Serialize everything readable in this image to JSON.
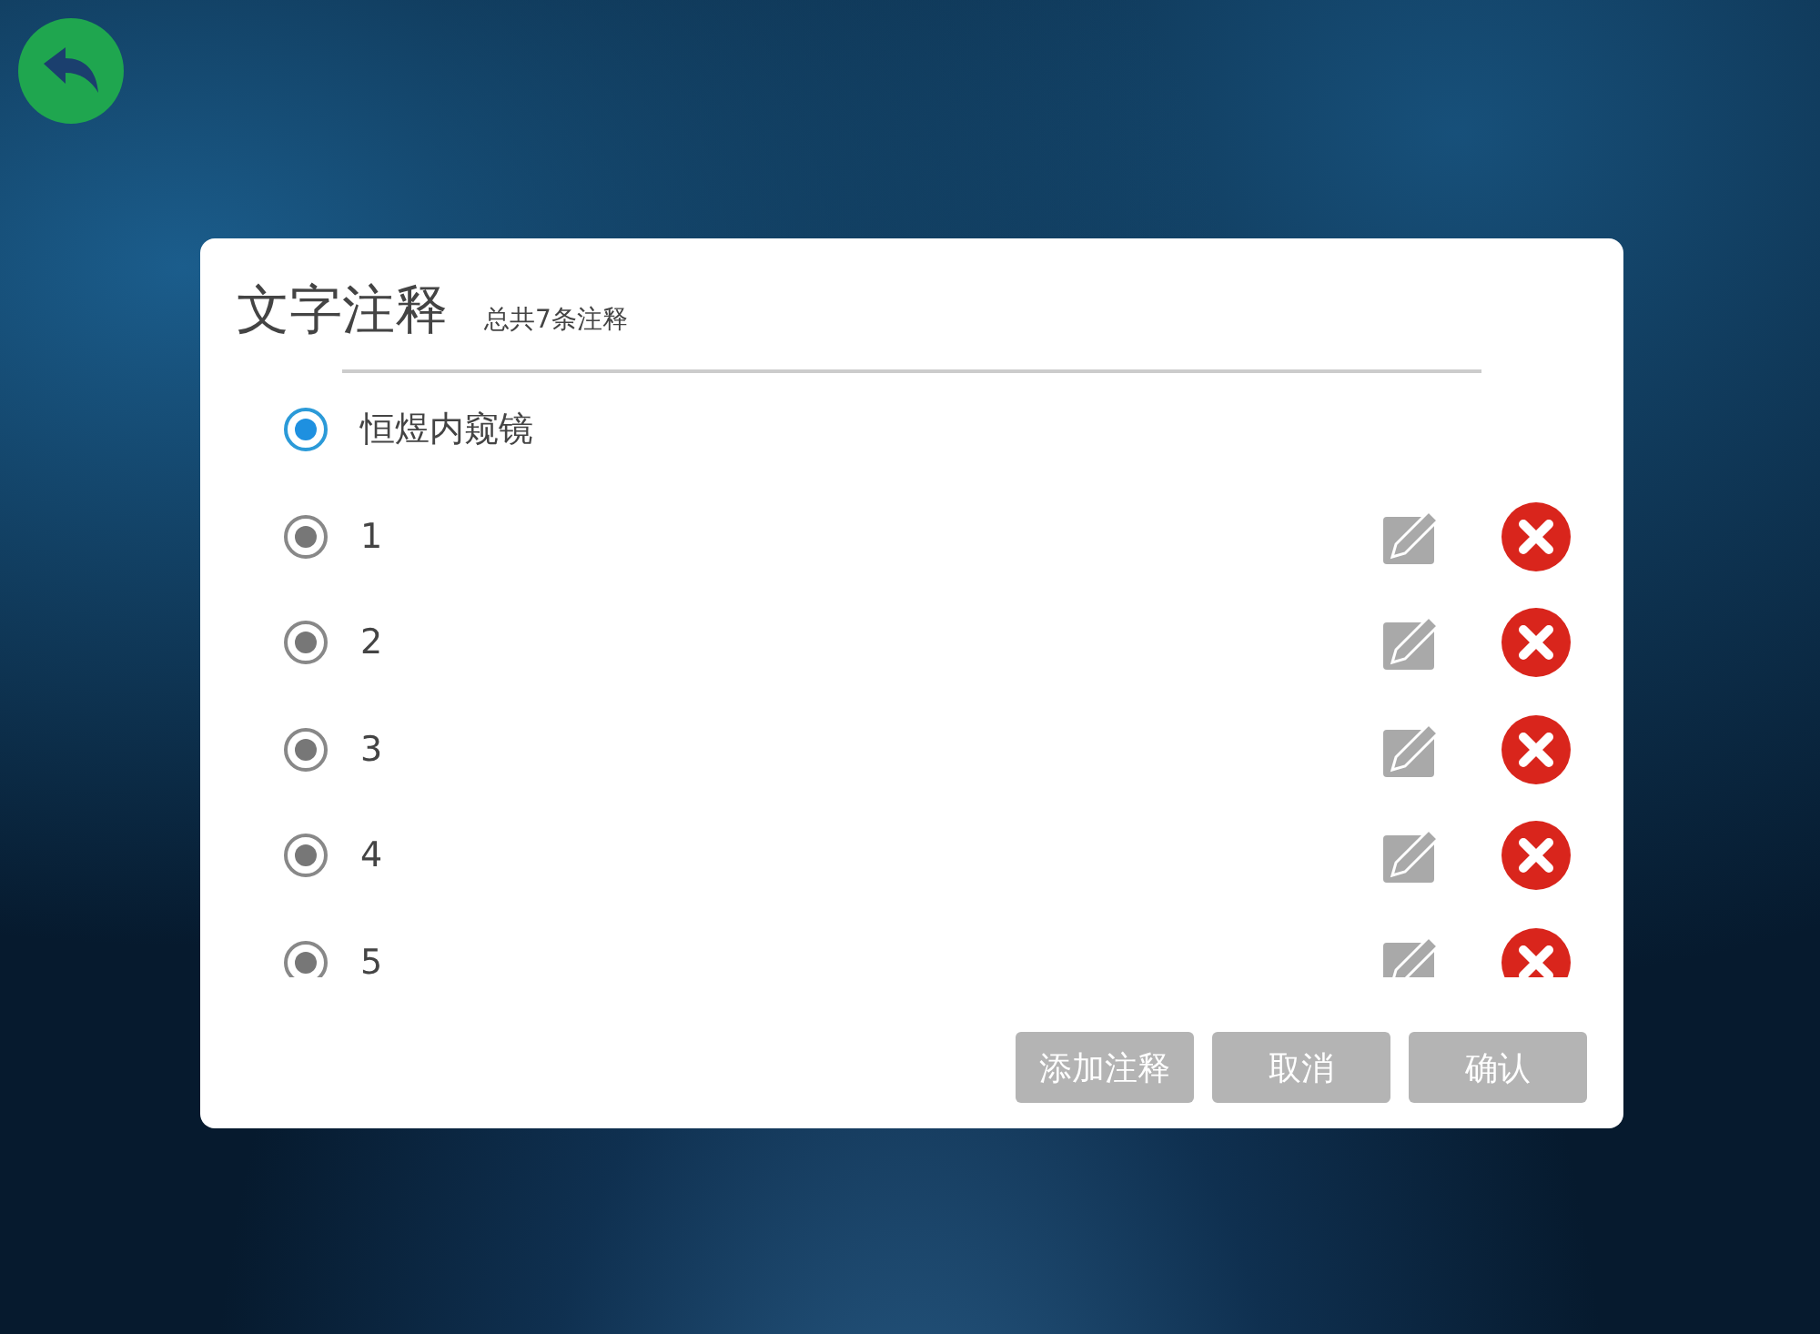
{
  "dialog": {
    "title": "文字注释",
    "count": "总共7条注释",
    "options": [
      {
        "label": "恒煜内窥镜",
        "checked": true,
        "disabled": false,
        "editable": false
      },
      {
        "label": "1",
        "checked": true,
        "disabled": true,
        "editable": true
      },
      {
        "label": "2",
        "checked": true,
        "disabled": true,
        "editable": true
      },
      {
        "label": "3",
        "checked": true,
        "disabled": true,
        "editable": true
      },
      {
        "label": "4",
        "checked": true,
        "disabled": true,
        "editable": true
      },
      {
        "label": "5",
        "checked": true,
        "disabled": true,
        "editable": true
      }
    ],
    "buttons": [
      "添加注释",
      "取消",
      "确认"
    ]
  }
}
